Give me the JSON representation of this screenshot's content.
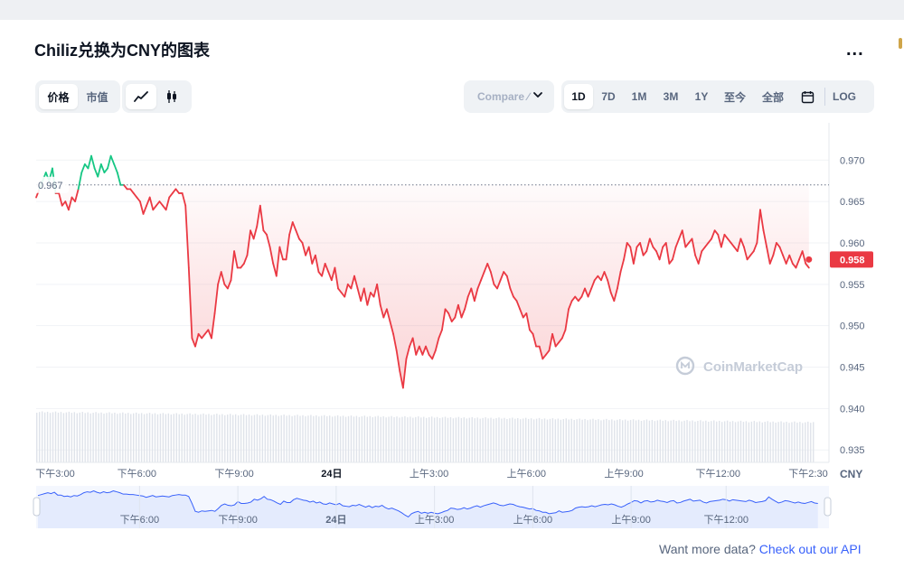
{
  "title": "Chiliz兑换为CNY的图表",
  "more_label": "...",
  "toggles": {
    "price_label": "价格",
    "marketcap_label": "市值"
  },
  "chart_types": [
    "line-chart-icon",
    "candlestick-icon"
  ],
  "compare": {
    "label": "Compare ∕"
  },
  "ranges": [
    "1D",
    "7D",
    "1M",
    "3M",
    "1Y",
    "至今",
    "全部"
  ],
  "active_range": "1D",
  "calendar_icon": "calendar-icon",
  "log_label": "LOG",
  "watermark": "CoinMarketCap",
  "footer": {
    "text": "Want more data?",
    "link": "Check out our API"
  },
  "colors": {
    "up": "#16c784",
    "down": "#ea3943",
    "accent": "#3861fb",
    "navigator_fill": "#e4ebfd"
  },
  "chart_data": {
    "type": "line",
    "title": "",
    "xlabel": "",
    "ylabel": "",
    "unit": "CNY",
    "ylim": [
      0.9335,
      0.9745
    ],
    "yticks": [
      0.935,
      0.94,
      0.945,
      0.95,
      0.955,
      0.96,
      0.965,
      0.97
    ],
    "ytick_labels": [
      "0.935",
      "0.940",
      "0.945",
      "0.950",
      "0.955",
      "0.960",
      "0.965",
      "0.970"
    ],
    "x_range": [
      0,
      24
    ],
    "xticks": [
      0.1,
      3.1,
      6.1,
      9.1,
      12.1,
      15.1,
      18.1,
      21.0,
      23.6
    ],
    "xtick_labels": [
      "下午3:00",
      "下午6:00",
      "下午9:00",
      "24日",
      "上午3:00",
      "上午6:00",
      "上午9:00",
      "下午12:00",
      "下午2:30"
    ],
    "reference": {
      "value": 0.967,
      "label": "0.967"
    },
    "last": {
      "value": 0.958,
      "label": "0.958"
    },
    "grid": true,
    "x": [
      0.0,
      0.1,
      0.2,
      0.3,
      0.4,
      0.5,
      0.6,
      0.7,
      0.8,
      0.9,
      1.0,
      1.1,
      1.2,
      1.3,
      1.4,
      1.5,
      1.6,
      1.7,
      1.8,
      1.9,
      2.0,
      2.1,
      2.2,
      2.3,
      2.4,
      2.5,
      2.6,
      2.7,
      2.8,
      2.9,
      3.0,
      3.1,
      3.2,
      3.3,
      3.4,
      3.5,
      3.6,
      3.7,
      3.8,
      3.9,
      4.0,
      4.1,
      4.2,
      4.3,
      4.4,
      4.5,
      4.6,
      4.7,
      4.8,
      4.9,
      5.0,
      5.1,
      5.2,
      5.3,
      5.4,
      5.5,
      5.6,
      5.7,
      5.8,
      5.9,
      6.0,
      6.1,
      6.2,
      6.3,
      6.4,
      6.5,
      6.6,
      6.7,
      6.8,
      6.9,
      7.0,
      7.1,
      7.2,
      7.3,
      7.4,
      7.5,
      7.6,
      7.7,
      7.8,
      7.9,
      8.0,
      8.1,
      8.2,
      8.3,
      8.4,
      8.5,
      8.6,
      8.7,
      8.8,
      8.9,
      9.0,
      9.1,
      9.2,
      9.3,
      9.4,
      9.5,
      9.6,
      9.7,
      9.8,
      9.9,
      10.0,
      10.1,
      10.2,
      10.3,
      10.4,
      10.5,
      10.6,
      10.7,
      10.8,
      10.9,
      11.0,
      11.1,
      11.2,
      11.3,
      11.4,
      11.5,
      11.6,
      11.7,
      11.8,
      11.9,
      12.0,
      12.1,
      12.2,
      12.3,
      12.4,
      12.5,
      12.6,
      12.7,
      12.8,
      12.9,
      13.0,
      13.1,
      13.2,
      13.3,
      13.4,
      13.5,
      13.6,
      13.7,
      13.8,
      13.9,
      14.0,
      14.1,
      14.2,
      14.3,
      14.4,
      14.5,
      14.6,
      14.7,
      14.8,
      14.9,
      15.0,
      15.1,
      15.2,
      15.3,
      15.4,
      15.5,
      15.6,
      15.7,
      15.8,
      15.9,
      16.0,
      16.1,
      16.2,
      16.3,
      16.4,
      16.5,
      16.6,
      16.7,
      16.8,
      16.9,
      17.0,
      17.1,
      17.2,
      17.3,
      17.4,
      17.5,
      17.6,
      17.7,
      17.8,
      17.9,
      18.0,
      18.1,
      18.2,
      18.3,
      18.4,
      18.5,
      18.6,
      18.7,
      18.8,
      18.9,
      19.0,
      19.1,
      19.2,
      19.3,
      19.4,
      19.5,
      19.6,
      19.7,
      19.8,
      19.9,
      20.0,
      20.1,
      20.2,
      20.3,
      20.4,
      20.5,
      20.6,
      20.7,
      20.8,
      20.9,
      21.0,
      21.1,
      21.2,
      21.3,
      21.4,
      21.5,
      21.6,
      21.7,
      21.8,
      21.9,
      22.0,
      22.1,
      22.2,
      22.3,
      22.4,
      22.5,
      22.6,
      22.7,
      22.8,
      22.9,
      23.0,
      23.1,
      23.2,
      23.3,
      23.4,
      23.5,
      23.6,
      23.7,
      23.8
    ],
    "values": [
      0.9655,
      0.9665,
      0.9675,
      0.9685,
      0.9675,
      0.969,
      0.966,
      0.966,
      0.9645,
      0.965,
      0.964,
      0.9655,
      0.965,
      0.9665,
      0.9685,
      0.9695,
      0.969,
      0.9705,
      0.969,
      0.968,
      0.9695,
      0.9685,
      0.969,
      0.9705,
      0.9695,
      0.9685,
      0.967,
      0.967,
      0.9665,
      0.9665,
      0.966,
      0.9655,
      0.965,
      0.9635,
      0.9645,
      0.9655,
      0.964,
      0.9645,
      0.965,
      0.9645,
      0.964,
      0.9655,
      0.966,
      0.9665,
      0.966,
      0.966,
      0.9645,
      0.957,
      0.9485,
      0.9475,
      0.949,
      0.9485,
      0.949,
      0.9495,
      0.9485,
      0.9515,
      0.955,
      0.9565,
      0.955,
      0.9545,
      0.9555,
      0.959,
      0.957,
      0.957,
      0.9575,
      0.9585,
      0.9615,
      0.9605,
      0.962,
      0.9645,
      0.9615,
      0.961,
      0.9595,
      0.9575,
      0.956,
      0.9595,
      0.958,
      0.958,
      0.961,
      0.9625,
      0.9615,
      0.9605,
      0.96,
      0.9585,
      0.9595,
      0.9575,
      0.9585,
      0.9565,
      0.956,
      0.9575,
      0.9565,
      0.9555,
      0.957,
      0.9545,
      0.954,
      0.9535,
      0.955,
      0.9545,
      0.956,
      0.9545,
      0.953,
      0.9545,
      0.9525,
      0.954,
      0.9535,
      0.955,
      0.9525,
      0.951,
      0.952,
      0.9505,
      0.949,
      0.947,
      0.9445,
      0.9425,
      0.946,
      0.9475,
      0.9485,
      0.9465,
      0.9475,
      0.9465,
      0.9475,
      0.9465,
      0.946,
      0.947,
      0.9485,
      0.9495,
      0.952,
      0.9515,
      0.9505,
      0.951,
      0.9525,
      0.951,
      0.952,
      0.9535,
      0.9545,
      0.953,
      0.9545,
      0.9555,
      0.9565,
      0.9575,
      0.9565,
      0.955,
      0.9545,
      0.9555,
      0.9565,
      0.956,
      0.9545,
      0.9535,
      0.953,
      0.952,
      0.951,
      0.9515,
      0.9495,
      0.949,
      0.9475,
      0.9475,
      0.946,
      0.9465,
      0.947,
      0.949,
      0.9475,
      0.948,
      0.9485,
      0.9495,
      0.952,
      0.953,
      0.9535,
      0.953,
      0.9535,
      0.9545,
      0.9535,
      0.9545,
      0.9555,
      0.956,
      0.9555,
      0.9565,
      0.9555,
      0.954,
      0.953,
      0.9545,
      0.9565,
      0.958,
      0.96,
      0.9595,
      0.9575,
      0.9595,
      0.96,
      0.9585,
      0.959,
      0.9605,
      0.9595,
      0.959,
      0.958,
      0.9595,
      0.96,
      0.9575,
      0.958,
      0.9595,
      0.9605,
      0.9615,
      0.9595,
      0.96,
      0.9605,
      0.9585,
      0.9575,
      0.959,
      0.9595,
      0.96,
      0.9605,
      0.9615,
      0.961,
      0.9595,
      0.961,
      0.9605,
      0.96,
      0.9595,
      0.959,
      0.9605,
      0.9595,
      0.958,
      0.9585,
      0.959,
      0.96,
      0.964,
      0.9615,
      0.9595,
      0.9575,
      0.9585,
      0.96,
      0.9595,
      0.9585,
      0.9575,
      0.9585,
      0.9575,
      0.957,
      0.958,
      0.959,
      0.9575,
      0.957,
      0.958,
      0.959,
      0.958
    ]
  },
  "volume_bars": 290,
  "navigator": {
    "tick_labels": [
      "下午6:00",
      "下午9:00",
      "24日",
      "上午3:00",
      "上午6:00",
      "上午9:00",
      "下午12:00"
    ],
    "tick_x": [
      3.1,
      6.1,
      9.1,
      12.1,
      15.1,
      18.1,
      21.0
    ]
  }
}
